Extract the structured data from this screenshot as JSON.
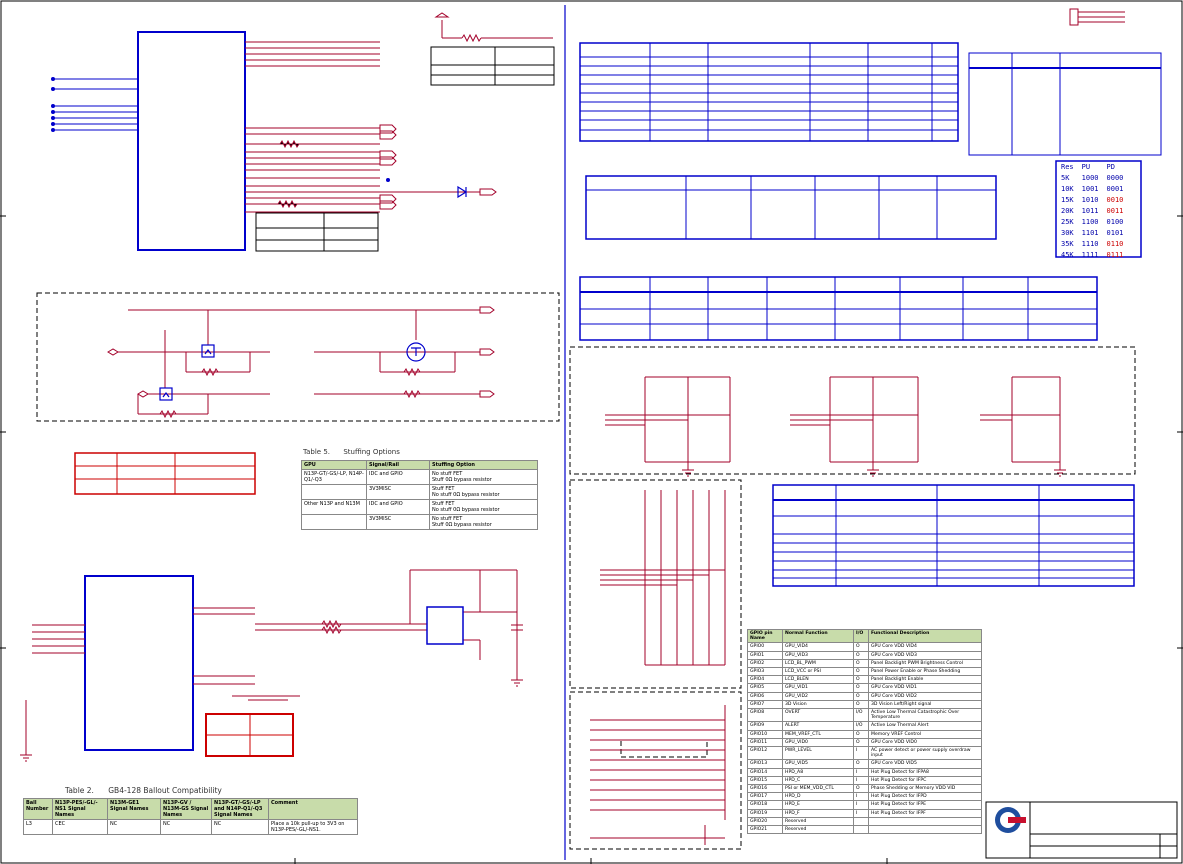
{
  "res_table": {
    "headers": [
      "Res",
      "PU",
      "PD"
    ],
    "rows": [
      [
        "5K",
        "1000",
        "0000"
      ],
      [
        "10K",
        "1001",
        "0001"
      ],
      [
        "15K",
        "1010",
        "0010"
      ],
      [
        "20K",
        "1011",
        "0011"
      ],
      [
        "25K",
        "1100",
        "0100"
      ],
      [
        "30K",
        "1101",
        "0101"
      ],
      [
        "35K",
        "1110",
        "0110"
      ],
      [
        "45K",
        "1111",
        "0111"
      ]
    ]
  },
  "stuffing": {
    "caption": "Table 5.      Stuffing Options",
    "headers": [
      "GPU",
      "Signal/Rail",
      "Stuffing Option"
    ],
    "rows": [
      [
        "N13P-GT/-GS/-LP, N14P-Q1/-Q3",
        "IDC and GPIO",
        "No stuff FET\nStuff 0Ω bypass resistor"
      ],
      [
        "",
        "3V3MISC",
        "Stuff FET\nNo stuff 0Ω bypass resistor"
      ],
      [
        "Other N13P and N13M",
        "IDC and GPIO",
        "Stuff FET\nNo stuff 0Ω bypass resistor"
      ],
      [
        "",
        "3V3MISC",
        "No stuff FET\nStuff 0Ω bypass resistor"
      ]
    ]
  },
  "ballout": {
    "caption": "Table 2.      GB4-128 Ballout Compatibility",
    "headers": [
      "Ball Number",
      "N13P-PES/-GL/-NS1 Signal Names",
      "N13M-GE1 Signal Names",
      "N13P-GV / N13M-GS Signal Names",
      "N13P-GT/-GS/-LP and N14P-Q1/-Q3 Signal Names",
      "Comment"
    ],
    "rows": [
      [
        "L3",
        "CEC",
        "NC",
        "NC",
        "NC",
        "Place a 10k pull-up to 3V3 on N13P-PES/-GL/-NS1."
      ]
    ]
  },
  "gpio": {
    "headers": [
      "GPIO pin Name",
      "Normal Function",
      "I/O",
      "Functional Description"
    ],
    "rows": [
      [
        "GPIO0",
        "GPU_VID4",
        "O",
        "GPU Core VDD VID4"
      ],
      [
        "GPIO1",
        "GPU_VID3",
        "O",
        "GPU Core VDD VID3"
      ],
      [
        "GPIO2",
        "LCD_BL_PWM",
        "O",
        "Panel Backlight PWM Brightness Control"
      ],
      [
        "GPIO3",
        "LCD_VCC or PSI",
        "O",
        "Panel Power Enable or Phase Shedding"
      ],
      [
        "GPIO4",
        "LCD_BLEN",
        "O",
        "Panel Backlight Enable"
      ],
      [
        "GPIO5",
        "GPU_VID1",
        "O",
        "GPU Core VDD VID1"
      ],
      [
        "GPIO6",
        "GPU_VID2",
        "O",
        "GPU Core VDD VID2"
      ],
      [
        "GPIO7",
        "3D Vision",
        "O",
        "3D Vision Left/Right signal"
      ],
      [
        "GPIO8",
        "OVERT",
        "I/O",
        "Active Low Thermal Catastrophic Over Temperature"
      ],
      [
        "GPIO9",
        "ALERT",
        "I/O",
        "Active Low Thermal Alert"
      ],
      [
        "GPIO10",
        "MEM_VREF_CTL",
        "O",
        "Memory VREF Control"
      ],
      [
        "GPIO11",
        "GPU_VID0",
        "O",
        "GPU Core VDD VID0"
      ],
      [
        "GPIO12",
        "PWR_LEVEL",
        "I",
        "AC power detect or power supply overdraw input"
      ],
      [
        "GPIO13",
        "GPU_VID5",
        "O",
        "GPU Core VDD VID5"
      ],
      [
        "GPIO14",
        "HPD_A8",
        "I",
        "Hot Plug Detect for IFPA8"
      ],
      [
        "GPIO15",
        "HPD_C",
        "I",
        "Hot Plug Detect for IFPC"
      ],
      [
        "GPIO16",
        "PSI or MEM_VDD_CTL",
        "O",
        "Phase Shedding or Memory VDD VID"
      ],
      [
        "GPIO17",
        "HPD_D",
        "I",
        "Hot Plug Detect for IFPD"
      ],
      [
        "GPIO18",
        "HPD_E",
        "I",
        "Hot Plug Detect for IFPE"
      ],
      [
        "GPIO19",
        "HPD_F",
        "I",
        "Hot Plug Detect for IFPF"
      ],
      [
        "GPIO20",
        "Reserved",
        "",
        ""
      ],
      [
        "GPIO21",
        "Reserved",
        "",
        ""
      ]
    ]
  },
  "colors": {
    "wire": "#a3002a",
    "frame": "#0000cc",
    "dash": "#000000",
    "header_fill": "#c8dcaa",
    "logo_blue": "#1f4e9e",
    "logo_red": "#c8102e"
  }
}
